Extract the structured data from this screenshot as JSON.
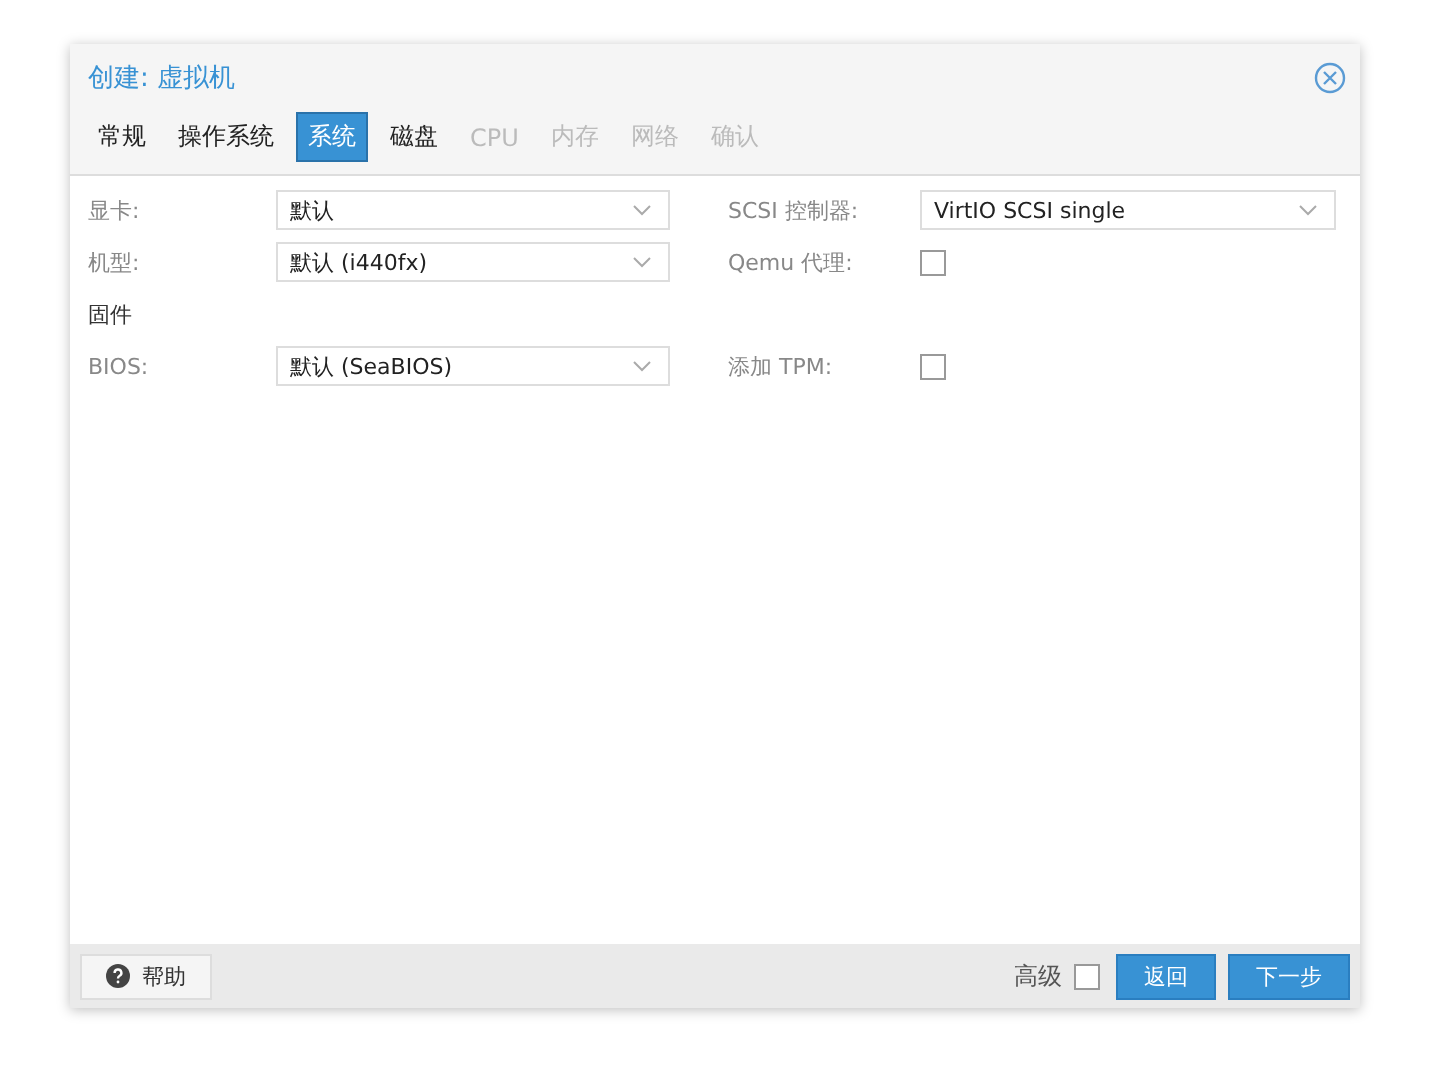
{
  "window": {
    "title": "创建: 虚拟机"
  },
  "tabs": [
    {
      "label": "常规",
      "selected": false,
      "disabled": false
    },
    {
      "label": "操作系统",
      "selected": false,
      "disabled": false
    },
    {
      "label": "系统",
      "selected": true,
      "disabled": false
    },
    {
      "label": "磁盘",
      "selected": false,
      "disabled": false
    },
    {
      "label": "CPU",
      "selected": false,
      "disabled": true
    },
    {
      "label": "内存",
      "selected": false,
      "disabled": true
    },
    {
      "label": "网络",
      "selected": false,
      "disabled": true
    },
    {
      "label": "确认",
      "selected": false,
      "disabled": true
    }
  ],
  "rows": [
    {
      "left": {
        "kind": "select",
        "label": "显卡:",
        "value": "默认"
      },
      "right": {
        "kind": "select",
        "label": "SCSI 控制器:",
        "value": "VirtIO SCSI single"
      }
    },
    {
      "left": {
        "kind": "select",
        "label": "机型:",
        "value": "默认 (i440fx)"
      },
      "right": {
        "kind": "checkbox",
        "label": "Qemu 代理:",
        "checked": false
      }
    },
    {
      "left": {
        "kind": "heading",
        "label": "固件"
      }
    },
    {
      "left": {
        "kind": "select",
        "label": "BIOS:",
        "value": "默认 (SeaBIOS)"
      },
      "right": {
        "kind": "checkbox",
        "label": "添加 TPM:",
        "checked": false
      }
    }
  ],
  "footer": {
    "help": "帮助",
    "advanced": {
      "label": "高级",
      "checked": false
    },
    "buttons": [
      "返回",
      "下一步"
    ]
  }
}
